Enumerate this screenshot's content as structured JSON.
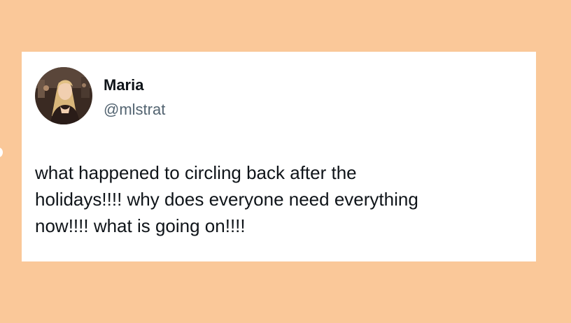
{
  "page": {
    "background_color": "#fac899"
  },
  "tweet": {
    "author": {
      "name": "Maria",
      "handle": "@mlstrat",
      "avatar_icon": "profile-photo"
    },
    "text_lines": [
      "what happened to circling back after the",
      "holidays!!!! why does everyone need everything",
      "now!!!! what is going on!!!!"
    ],
    "card_color": "#ffffff",
    "name_color": "#0f1419",
    "handle_color": "#536471"
  }
}
